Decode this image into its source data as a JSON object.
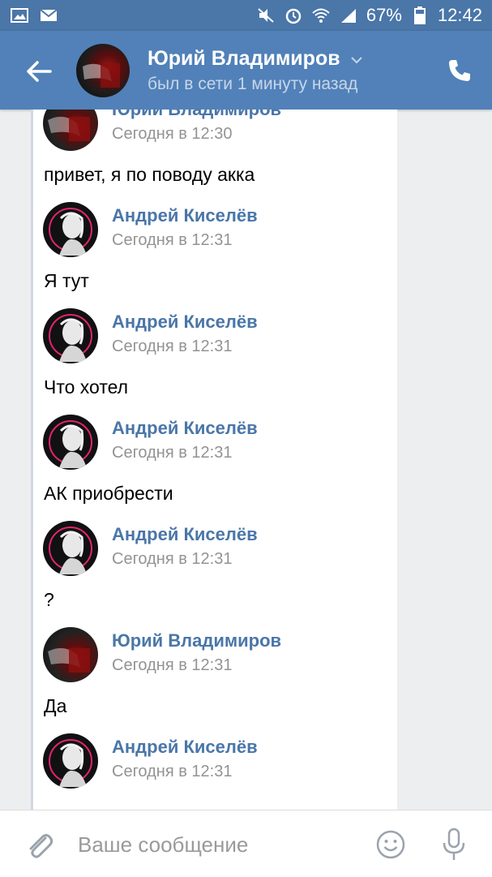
{
  "status_bar": {
    "battery": "67%",
    "time": "12:42",
    "icons": [
      "image-icon",
      "mail-icon",
      "mute-icon",
      "alarm-icon",
      "wifi-icon",
      "signal-icon",
      "battery-icon"
    ]
  },
  "header": {
    "name": "Юрий Владимиров",
    "status": "был в сети 1 минуту назад",
    "icons": [
      "back-arrow-icon",
      "chevron-down-icon",
      "phone-icon"
    ]
  },
  "messages": [
    {
      "sender": "Юрий Владимиров",
      "time": "Сегодня в 12:30",
      "text": "привет, я по поводу акка",
      "avatar": "yuri"
    },
    {
      "sender": "Андрей Киселёв",
      "time": "Сегодня в 12:31",
      "text": "Я тут",
      "avatar": "andrey"
    },
    {
      "sender": "Андрей Киселёв",
      "time": "Сегодня в 12:31",
      "text": "Что хотел",
      "avatar": "andrey"
    },
    {
      "sender": "Андрей Киселёв",
      "time": "Сегодня в 12:31",
      "text": "АК приобрести",
      "avatar": "andrey"
    },
    {
      "sender": "Андрей Киселёв",
      "time": "Сегодня в 12:31",
      "text": "?",
      "avatar": "andrey"
    },
    {
      "sender": "Юрий Владимиров",
      "time": "Сегодня в 12:31",
      "text": "Да",
      "avatar": "yuri"
    },
    {
      "sender": "Андрей Киселёв",
      "time": "Сегодня в 12:31",
      "text": "",
      "avatar": "andrey"
    }
  ],
  "composer": {
    "placeholder": "Ваше сообщение",
    "icons": [
      "paperclip-icon",
      "emoji-icon",
      "microphone-icon"
    ]
  },
  "colors": {
    "header": "#5181b8",
    "status_bar": "#4a76a8",
    "sender_name": "#4a76a8",
    "timestamp": "#939393",
    "background": "#edeef0"
  }
}
